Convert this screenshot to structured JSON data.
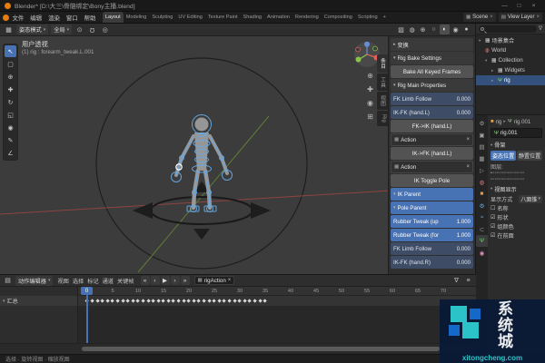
{
  "colors": {
    "accent": "#4772b3",
    "teal": "#2cc3c8",
    "wmblue": "#1668c8"
  },
  "window": {
    "title": "Blender* [D:\\大三\\骨骼绑定\\Bony主播.blend]",
    "minimize": "—",
    "maximize": "□",
    "close": "×"
  },
  "topbar": {
    "menus": [
      "文件",
      "编辑",
      "渲染",
      "窗口",
      "帮助"
    ],
    "workspaces": [
      {
        "label": "Layout",
        "cls": "active"
      },
      {
        "label": "Modeling"
      },
      {
        "label": "Sculpting"
      },
      {
        "label": "UV Editing"
      },
      {
        "label": "Texture Paint"
      },
      {
        "label": "Shading"
      },
      {
        "label": "Animation"
      },
      {
        "label": "Rendering"
      },
      {
        "label": "Compositing"
      },
      {
        "label": "Scripting"
      },
      {
        "label": "+"
      }
    ],
    "scene": {
      "icon": "▦",
      "label": "Scene",
      "close": "×"
    },
    "view_layer": {
      "icon": "▤",
      "label": "View Layer",
      "close": "×"
    }
  },
  "viewport": {
    "header": {
      "editor_icon": "▦",
      "dropdown": "▾",
      "mode_label": "姿态模式",
      "orientation_label": "全局",
      "pivot_icon": "⊙",
      "snap_icon": "Ω",
      "prop_icon": "◎",
      "right_icons": [
        {
          "name": "xray-toggle-icon",
          "glyph": "▨"
        },
        {
          "name": "overlays-toggle-icon",
          "glyph": "◍"
        },
        {
          "name": "gizmos-toggle-icon",
          "glyph": "⊕"
        },
        {
          "name": "wireframe-shading-icon",
          "glyph": "○"
        },
        {
          "name": "solid-shading-icon",
          "glyph": "◐",
          "cls": "active"
        },
        {
          "name": "material-preview-icon",
          "glyph": "◉"
        },
        {
          "name": "rendered-shading-icon",
          "glyph": "●"
        }
      ]
    },
    "overlay": {
      "view_label": "用户透视",
      "active_object": "(1) rig : forearm_tweak.L.001"
    },
    "toolbar": [
      {
        "name": "tweak-select-tool",
        "glyph": "↖",
        "cls": "active"
      },
      {
        "name": "select-box-tool",
        "glyph": "▢"
      },
      {
        "name": "cursor-tool",
        "glyph": "⊕"
      },
      {
        "name": "move-tool",
        "glyph": "✚"
      },
      {
        "name": "rotate-tool",
        "glyph": "↻"
      },
      {
        "name": "scale-tool",
        "glyph": "◱"
      },
      {
        "name": "transform-tool",
        "glyph": "◉"
      },
      {
        "name": "annotate-tool",
        "glyph": "✎"
      },
      {
        "name": "measure-tool",
        "glyph": "∠"
      }
    ],
    "gizmo_stack": [
      {
        "name": "zoom-icon",
        "glyph": "⊕"
      },
      {
        "name": "pan-icon",
        "glyph": "✚"
      },
      {
        "name": "camera-view-icon",
        "glyph": "◉"
      },
      {
        "name": "perspective-toggle-icon",
        "glyph": "⊞"
      }
    ],
    "sidebar_tabs": [
      {
        "label": "条目",
        "cls": "active"
      },
      {
        "label": "工具"
      },
      {
        "label": "视图"
      },
      {
        "label": "Rig"
      }
    ],
    "sidebar_rows": [
      {
        "type": "panel-header",
        "name": "transform-panel-header",
        "label": "变换",
        "arrow": "▸"
      },
      {
        "type": "panel-header",
        "name": "rig-bake-settings-header",
        "label": "Rig Bake Settings",
        "arrow": "▾"
      },
      {
        "type": "button",
        "name": "bake-all-keyed-frames-button",
        "label": "Bake All Keyed Frames"
      },
      {
        "type": "panel-header",
        "name": "rig-main-properties-header",
        "label": "Rig Main Properties",
        "arrow": "▾"
      },
      {
        "type": "slider",
        "name": "fk-limb-follow-l-slider",
        "label": "FK Limb Follow",
        "value": "0.000"
      },
      {
        "type": "slider",
        "name": "ik-fk-hand-l-slider",
        "label": "IK-FK (hand.L)",
        "value": "0.000"
      },
      {
        "type": "button",
        "name": "fk-to-ik-hand-l-button",
        "label": "FK->IK (hand.L)"
      },
      {
        "type": "action",
        "name": "action-field-l",
        "label": "Action",
        "icon": "▦",
        "close": "×"
      },
      {
        "type": "button",
        "name": "ik-to-fk-hand-l-button",
        "label": "IK->FK (hand.L)"
      },
      {
        "type": "action",
        "name": "action-field-r",
        "label": "Action",
        "icon": "▦",
        "close": "×"
      },
      {
        "type": "button",
        "name": "ik-toggle-pole-button",
        "label": "IK Toggle Pole"
      },
      {
        "type": "dropdown-blue",
        "name": "ik-parent-dropdown",
        "label": "IK Parent",
        "arrow": "▾"
      },
      {
        "type": "dropdown-blue",
        "name": "pole-parent-dropdown",
        "label": "Pole Parent",
        "arrow": "▾"
      },
      {
        "type": "slider-blue",
        "name": "rubber-tweak-up-slider",
        "label": "Rubber Tweak (up",
        "value": "1.000"
      },
      {
        "type": "slider-blue",
        "name": "rubber-tweak-for-slider",
        "label": "Rubber Tweak (for",
        "value": "1.000"
      },
      {
        "type": "slider",
        "name": "fk-limb-follow-r-slider",
        "label": "FK Limb Follow",
        "value": "0.000"
      },
      {
        "type": "slider",
        "name": "ik-fk-hand-r-slider",
        "label": "IK-FK (hand.R)",
        "value": "0.000"
      }
    ]
  },
  "outliner": {
    "filter_icon": "∇",
    "rows": [
      {
        "name": "outliner-scene-collection",
        "arrow": "▾",
        "icon": "▦",
        "icon_cls": "white",
        "label": "场景集合",
        "cls": "d0"
      },
      {
        "name": "outliner-world",
        "icon": "◍",
        "icon_cls": "red",
        "label": "World",
        "cls": "d1"
      },
      {
        "name": "outliner-collection",
        "arrow": "▾",
        "icon": "▦",
        "icon_cls": "white",
        "label": "Collection",
        "cls": "d1"
      },
      {
        "name": "outliner-widgets",
        "arrow": "▸",
        "icon": "▦",
        "icon_cls": "white",
        "label": "Widgets",
        "cls": "d2"
      },
      {
        "name": "outliner-rig",
        "arrow": "▸",
        "icon": "Ψ",
        "icon_cls": "green",
        "label": "rig",
        "cls": "d2 sel"
      }
    ]
  },
  "properties": {
    "tabs": [
      {
        "name": "tool-tab",
        "glyph": "⚙"
      },
      {
        "name": "render-tab",
        "glyph": "▣"
      },
      {
        "name": "output-tab",
        "glyph": "▤"
      },
      {
        "name": "view-layer-tab",
        "glyph": "▦"
      },
      {
        "name": "scene-tab",
        "glyph": "▷"
      },
      {
        "name": "world-tab",
        "glyph": "◍",
        "cls": "red"
      },
      {
        "name": "object-tab",
        "glyph": "■",
        "cls": "orange"
      },
      {
        "name": "modifier-tab",
        "glyph": "⚙",
        "cls": "blue"
      },
      {
        "name": "physics-tab",
        "glyph": "≈",
        "cls": "blue"
      },
      {
        "name": "constraint-tab",
        "glyph": "⊂"
      },
      {
        "name": "object-data-tab",
        "glyph": "Ψ",
        "cls": "green active"
      },
      {
        "name": "material-tab",
        "glyph": "◉",
        "cls": "pink"
      }
    ],
    "path": {
      "object_icon": "■",
      "object": "rig",
      "sep": "▸",
      "data_icon": "Ψ",
      "data": "rig.001"
    },
    "name_icon": "Ψ",
    "name_value": "rig.001",
    "skeleton_panel": {
      "arrow": "▾",
      "title": "骨架",
      "pose": "姿态位置",
      "rest": "静置位置",
      "layers_label": "图层:",
      "layers_row1": "▪▫▫▫▫▫▫▫▫▫▫▫▫▫▫▫",
      "layers_row2": "▫▫▫▫▫▫▫▫▫▫▫▫▫▫▫▫"
    },
    "display_panel": {
      "arrow": "▾",
      "title": "视图显示",
      "display_as_label": "显示方式",
      "display_as_value": "八面锥",
      "dropdown": "▾",
      "checks": [
        {
          "box": "☐",
          "label": "名称"
        },
        {
          "box": "☑",
          "label": "形状"
        },
        {
          "box": "☑",
          "label": "组颜色"
        },
        {
          "box": "☑",
          "label": "在前面"
        }
      ]
    }
  },
  "dopesheet": {
    "editor_icon": "▤",
    "dropdown": "▾",
    "mode_label": "动作编辑器",
    "menus": [
      "视图",
      "选择",
      "标记",
      "通道",
      "关键帧"
    ],
    "transport": [
      {
        "name": "jump-to-start-button",
        "glyph": "«"
      },
      {
        "name": "prev-keyframe-button",
        "glyph": "‹"
      },
      {
        "name": "play-button",
        "glyph": "▶"
      },
      {
        "name": "next-keyframe-button",
        "glyph": "›"
      },
      {
        "name": "jump-to-end-button",
        "glyph": "»"
      }
    ],
    "action": {
      "icon": "▦",
      "label": "rigAction",
      "close": "×"
    },
    "right_icons": [
      {
        "name": "filter-icon",
        "glyph": "∇"
      },
      {
        "name": "options-icon",
        "glyph": "≡"
      }
    ],
    "channel": {
      "arrow": "▾",
      "label": "汇总"
    },
    "ruler": [
      "0",
      "5",
      "10",
      "15",
      "20",
      "25",
      "30",
      "35",
      "40",
      "45",
      "50",
      "55",
      "60",
      "65",
      "70"
    ],
    "keyframes": [
      0,
      1,
      2,
      3,
      4,
      5,
      6,
      7,
      8,
      9,
      10,
      11,
      12,
      13,
      14,
      15,
      16,
      17,
      18,
      19,
      20,
      21,
      22,
      23,
      24,
      25,
      26,
      27,
      28,
      29,
      30,
      31,
      32,
      33,
      34,
      35
    ],
    "playhead_label": "0"
  },
  "statusbar": {
    "left": "选择   ·   旋转视图   ·   缩放视图"
  },
  "watermark": {
    "brand": "系统城",
    "url": "xitongcheng.com"
  }
}
